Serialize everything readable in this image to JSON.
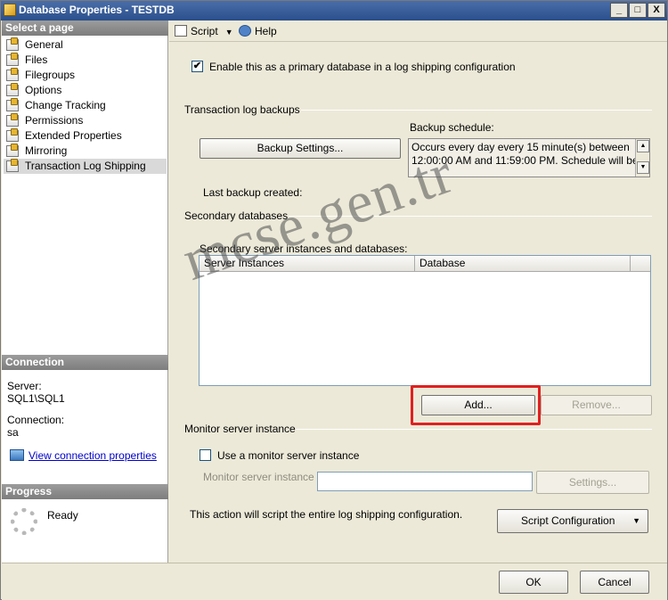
{
  "window": {
    "title": "Database Properties - TESTDB",
    "controls": {
      "minimize": "_",
      "maximize": "□",
      "close": "X"
    }
  },
  "left": {
    "select_page_header": "Select a page",
    "pages": [
      "General",
      "Files",
      "Filegroups",
      "Options",
      "Change Tracking",
      "Permissions",
      "Extended Properties",
      "Mirroring",
      "Transaction Log Shipping"
    ],
    "selected_page": "Transaction Log Shipping",
    "connection_header": "Connection",
    "server_label": "Server:",
    "server_value": "SQL1\\SQL1",
    "connection_label": "Connection:",
    "connection_value": "sa",
    "view_connection_link": "View connection properties",
    "progress_header": "Progress",
    "progress_status": "Ready"
  },
  "toolbar": {
    "script_label": "Script",
    "help_label": "Help"
  },
  "content": {
    "enable_primary_label": "Enable this as a primary database in a log shipping configuration",
    "enable_primary_checked": true,
    "tlog_backups_title": "Transaction log backups",
    "backup_settings_button": "Backup Settings...",
    "backup_schedule_label": "Backup schedule:",
    "backup_schedule_line1": "Occurs every day every 15 minute(s) between",
    "backup_schedule_line2": "12:00:00 AM and 11:59:00 PM. Schedule will be",
    "last_backup_label": "Last backup created:",
    "secondary_db_title": "Secondary databases",
    "secondary_instances_label": "Secondary server instances and databases:",
    "grid_columns": [
      "Server Instances",
      "Database"
    ],
    "add_button": "Add...",
    "remove_button": "Remove...",
    "monitor_title": "Monitor server instance",
    "use_monitor_label": "Use a monitor server instance",
    "use_monitor_checked": false,
    "monitor_instance_label": "Monitor server instance",
    "monitor_instance_value": "",
    "settings_button": "Settings...",
    "script_note": "This action will script the entire log shipping configuration.",
    "script_config_button": "Script Configuration"
  },
  "footer": {
    "ok_button": "OK",
    "cancel_button": "Cancel"
  },
  "watermark": "mcse.gen.tr",
  "colors": {
    "title_bar": "#2b4f8c",
    "highlight_box": "#e02020",
    "link": "#0000cc"
  }
}
